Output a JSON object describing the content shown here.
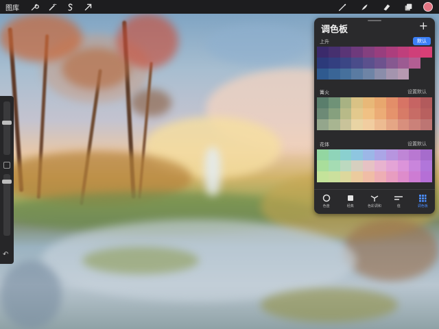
{
  "toolbar": {
    "gallery_label": "图库",
    "left_icons": [
      "wrench-icon",
      "magic-wand-icon",
      "selection-icon",
      "transform-arrow-icon"
    ],
    "right_icons": [
      "brush-icon",
      "smudge-icon",
      "eraser-icon",
      "layers-icon"
    ],
    "current_color": "#e27482"
  },
  "panel": {
    "title": "调色板",
    "add_label": "+",
    "palettes": [
      {
        "name": "上升",
        "default_label": "默认",
        "is_default": true,
        "rows": [
          [
            "#3b2a6b",
            "#46306f",
            "#5a3576",
            "#6e3a7c",
            "#84407f",
            "#983e7e",
            "#ac3e7d",
            "#bf3f7c",
            "#cf3f79",
            "#d83f76"
          ],
          [
            "#2c3a7a",
            "#333f80",
            "#3b4685",
            "#4a4c8a",
            "#5b508d",
            "#6d528e",
            "#865890",
            "#9c5b92",
            "#b35e93",
            ""
          ],
          [
            "#2f5a8f",
            "#3a6596",
            "#46709c",
            "#5a7ba2",
            "#6e84a6",
            "#8a8daa",
            "#a494ae",
            "#b799b1",
            "",
            ""
          ]
        ]
      },
      {
        "name": "篝火",
        "default_label": "设置默认",
        "is_default": false,
        "rows": [
          [
            "#5a7e6c",
            "#6f9277",
            "#a8b283",
            "#d9c285",
            "#e8b878",
            "#e8a76e",
            "#e38e69",
            "#d77465",
            "#c66463",
            "#b25a5c"
          ],
          [
            "#6d8a76",
            "#86a07e",
            "#b8ba88",
            "#e3c98d",
            "#f0c184",
            "#ecac76",
            "#e5936c",
            "#d77b67",
            "#c76c66",
            "#b8605f"
          ],
          [
            "#94a68c",
            "#a8b591",
            "#c9c39a",
            "#e9d4a4",
            "#f1cda0",
            "#edbb91",
            "#e5a685",
            "#d88f7d",
            "#cb8179",
            "#bd7573"
          ]
        ]
      },
      {
        "name": "花体",
        "default_label": "设置默认",
        "is_default": false,
        "rows": [
          [
            "#93d6a1",
            "#8fd4b9",
            "#8ad0cf",
            "#8ec6e0",
            "#9cb7e7",
            "#aba6e6",
            "#b795df",
            "#bf86d6",
            "#b978d2",
            "#a66ccc"
          ],
          [
            "#a9de9b",
            "#a5dcb3",
            "#bcd9bf",
            "#d6cfbf",
            "#e6c2c4",
            "#e8b3cf",
            "#e4a4d6",
            "#dc94da",
            "#c985dc",
            "#b176da"
          ],
          [
            "#c4e39a",
            "#cbe09d",
            "#dcd89d",
            "#ebcb9e",
            "#f0bda6",
            "#eeaeb4",
            "#e89dc0",
            "#de8ccb",
            "#cd7cd3",
            "#b56fd6"
          ]
        ]
      }
    ],
    "tabs": [
      {
        "label": "色盘",
        "icon": "disc-icon",
        "active": false
      },
      {
        "label": "经典",
        "icon": "square-icon",
        "active": false
      },
      {
        "label": "色彩调和",
        "icon": "harmony-icon",
        "active": false
      },
      {
        "label": "值",
        "icon": "sliders-icon",
        "active": false
      },
      {
        "label": "调色板",
        "icon": "grid-icon",
        "active": true
      }
    ]
  },
  "sidebar": {
    "icons": [
      "brush-size-slider",
      "modify-icon",
      "opacity-slider",
      "undo-icon"
    ]
  }
}
